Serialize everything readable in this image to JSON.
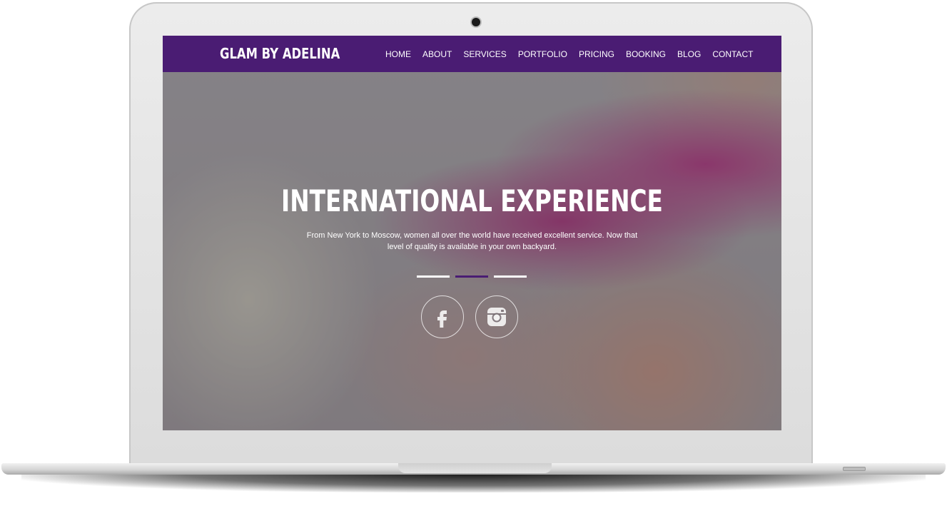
{
  "brand": {
    "name": "GLAM BY ADELINA"
  },
  "nav": {
    "items": [
      {
        "label": "HOME"
      },
      {
        "label": "ABOUT"
      },
      {
        "label": "SERVICES"
      },
      {
        "label": "PORTFOLIO"
      },
      {
        "label": "PRICING"
      },
      {
        "label": "BOOKING"
      },
      {
        "label": "BLOG"
      },
      {
        "label": "CONTACT"
      }
    ]
  },
  "hero": {
    "title": "INTERNATIONAL EXPERIENCE",
    "subtitle": "From New York to Moscow, women all over the world have received excellent service. Now that level of quality is available in your own backyard.",
    "slider": {
      "count": 3,
      "active_index": 1
    }
  },
  "social": [
    {
      "icon": "facebook-icon"
    },
    {
      "icon": "instagram-icon"
    }
  ],
  "colors": {
    "brand_purple": "#4a1c73",
    "text_white": "#ffffff"
  }
}
